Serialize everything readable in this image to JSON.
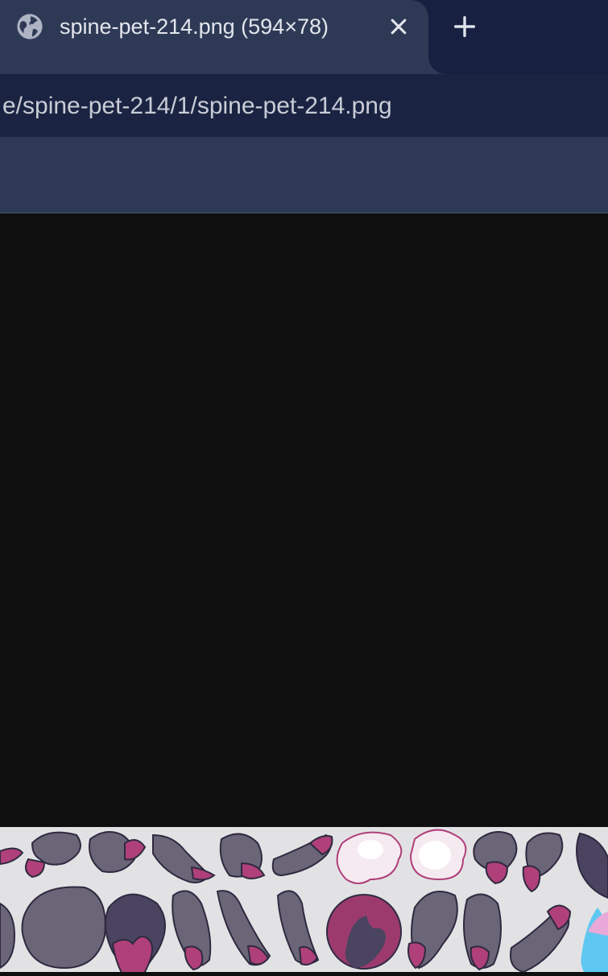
{
  "tab": {
    "title": "spine-pet-214.png (594×78)",
    "favicon": "globe-icon",
    "close": "close-icon"
  },
  "new_tab": "plus-icon",
  "address_bar": {
    "url": "e/spine-pet-214/1/spine-pet-214.png"
  },
  "colors": {
    "tabstrip": "#172040",
    "active_tab": "#2e3a55",
    "omnibox": "#1a2442",
    "viewport": "#0f0f10",
    "image_bg": "#e2e2e4",
    "part_fill": "#6b6578",
    "part_dark": "#4a4460",
    "accent_pink": "#b0407a"
  }
}
